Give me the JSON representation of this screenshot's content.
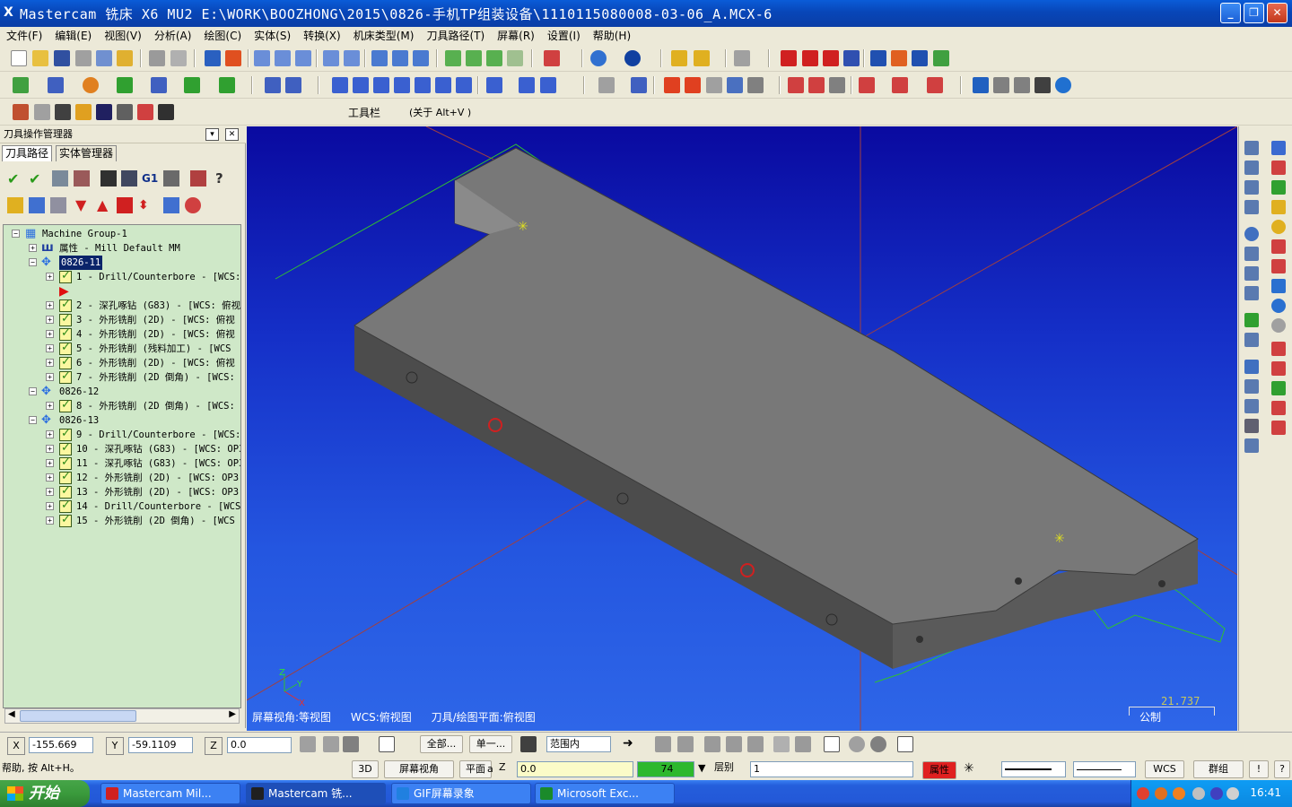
{
  "window": {
    "title": "Mastercam 铣床 X6 MU2  E:\\WORK\\BOOZHONG\\2015\\0826-手机TP组装设备\\1110115080008-03-06_A.MCX-6",
    "icon": "X",
    "min": "_",
    "max": "❐",
    "close": "✕"
  },
  "menu": [
    "文件(F)",
    "编辑(E)",
    "视图(V)",
    "分析(A)",
    "绘图(C)",
    "实体(S)",
    "转换(X)",
    "机床类型(M)",
    "刀具路径(T)",
    "屏幕(R)",
    "设置(I)",
    "帮助(H)"
  ],
  "toolbar3": {
    "label": "工具栏",
    "about": "(关于 Alt+V )"
  },
  "panel": {
    "title": "刀具操作管理器",
    "dropdown_glyph": "▾",
    "close_glyph": "✕",
    "tabs": [
      "刀具路径",
      "实体管理器"
    ],
    "g1_label": "G1",
    "tree": {
      "machine_group": "Machine Group-1",
      "properties": "属性 - Mill Default MM",
      "groups": [
        {
          "name": "0826-11",
          "ops": [
            "1 - Drill/Counterbore - [WCS:",
            "2 - 深孔啄钻 (G83) - [WCS: 俯视",
            "3 - 外形铣削 (2D) - [WCS: 俯视",
            "4 - 外形铣削 (2D) - [WCS: 俯视",
            "5 - 外形铣削 (残料加工) - [WCS",
            "6 - 外形铣削 (2D) - [WCS: 俯视",
            "7 - 外形铣削 (2D 倒角) - [WCS:"
          ]
        },
        {
          "name": "0826-12",
          "ops": [
            "8 - 外形铣削 (2D 倒角) - [WCS:"
          ]
        },
        {
          "name": "0826-13",
          "ops": [
            "9 - Drill/Counterbore - [WCS:",
            "10 - 深孔啄钻 (G83) - [WCS: OP3",
            "11 - 深孔啄钻 (G83) - [WCS: OP3",
            "12 - 外形铣削 (2D) - [WCS: OP3",
            "13 - 外形铣削 (2D) - [WCS: OP3",
            "14 - Drill/Counterbore - [WCS:",
            "15 - 外形铣削 (2D 倒角) - [WCS"
          ]
        }
      ]
    }
  },
  "viewport": {
    "screen_view": "屏幕视角:等视图",
    "wcs": "WCS:俯视图",
    "tplane": "刀具/绘图平面:俯视图",
    "scale_value": "21.737",
    "scale_unit": "公制",
    "axis_labels": {
      "x": "X",
      "y": "Y",
      "z": "Z"
    }
  },
  "status1": {
    "x_label": "X",
    "x_value": "-155.669",
    "y_label": "Y",
    "y_value": "-59.1109",
    "z_label": "Z",
    "z_value": "0.0",
    "all": "全部...",
    "single": "单一...",
    "range": "范围内"
  },
  "status2": {
    "help": "帮助, 按 Alt+H。",
    "btn_3d": "3D",
    "screen_view": "屏幕视角",
    "plane": "平面",
    "plane_a": "a",
    "z_label": "Z",
    "z_value": "0.0",
    "color_value": "74",
    "level_label": "层别",
    "level_value": "1",
    "attr": "属性",
    "wcs": "WCS",
    "group": "群组",
    "excl": "!",
    "end_btn": "?"
  },
  "taskbar": {
    "start": "开始",
    "tasks": [
      "Mastercam Mil...",
      "Mastercam 铣...",
      "GIF屏幕录象",
      "Microsoft Exc..."
    ],
    "clock": "16:41"
  },
  "colors": {
    "accent": "#0a246a",
    "viewport_top": "#0a0aa0",
    "viewport_bottom": "#2e66e8",
    "part": "#787878",
    "color_swatch": "#2db82d",
    "attr_red": "#e02020"
  }
}
